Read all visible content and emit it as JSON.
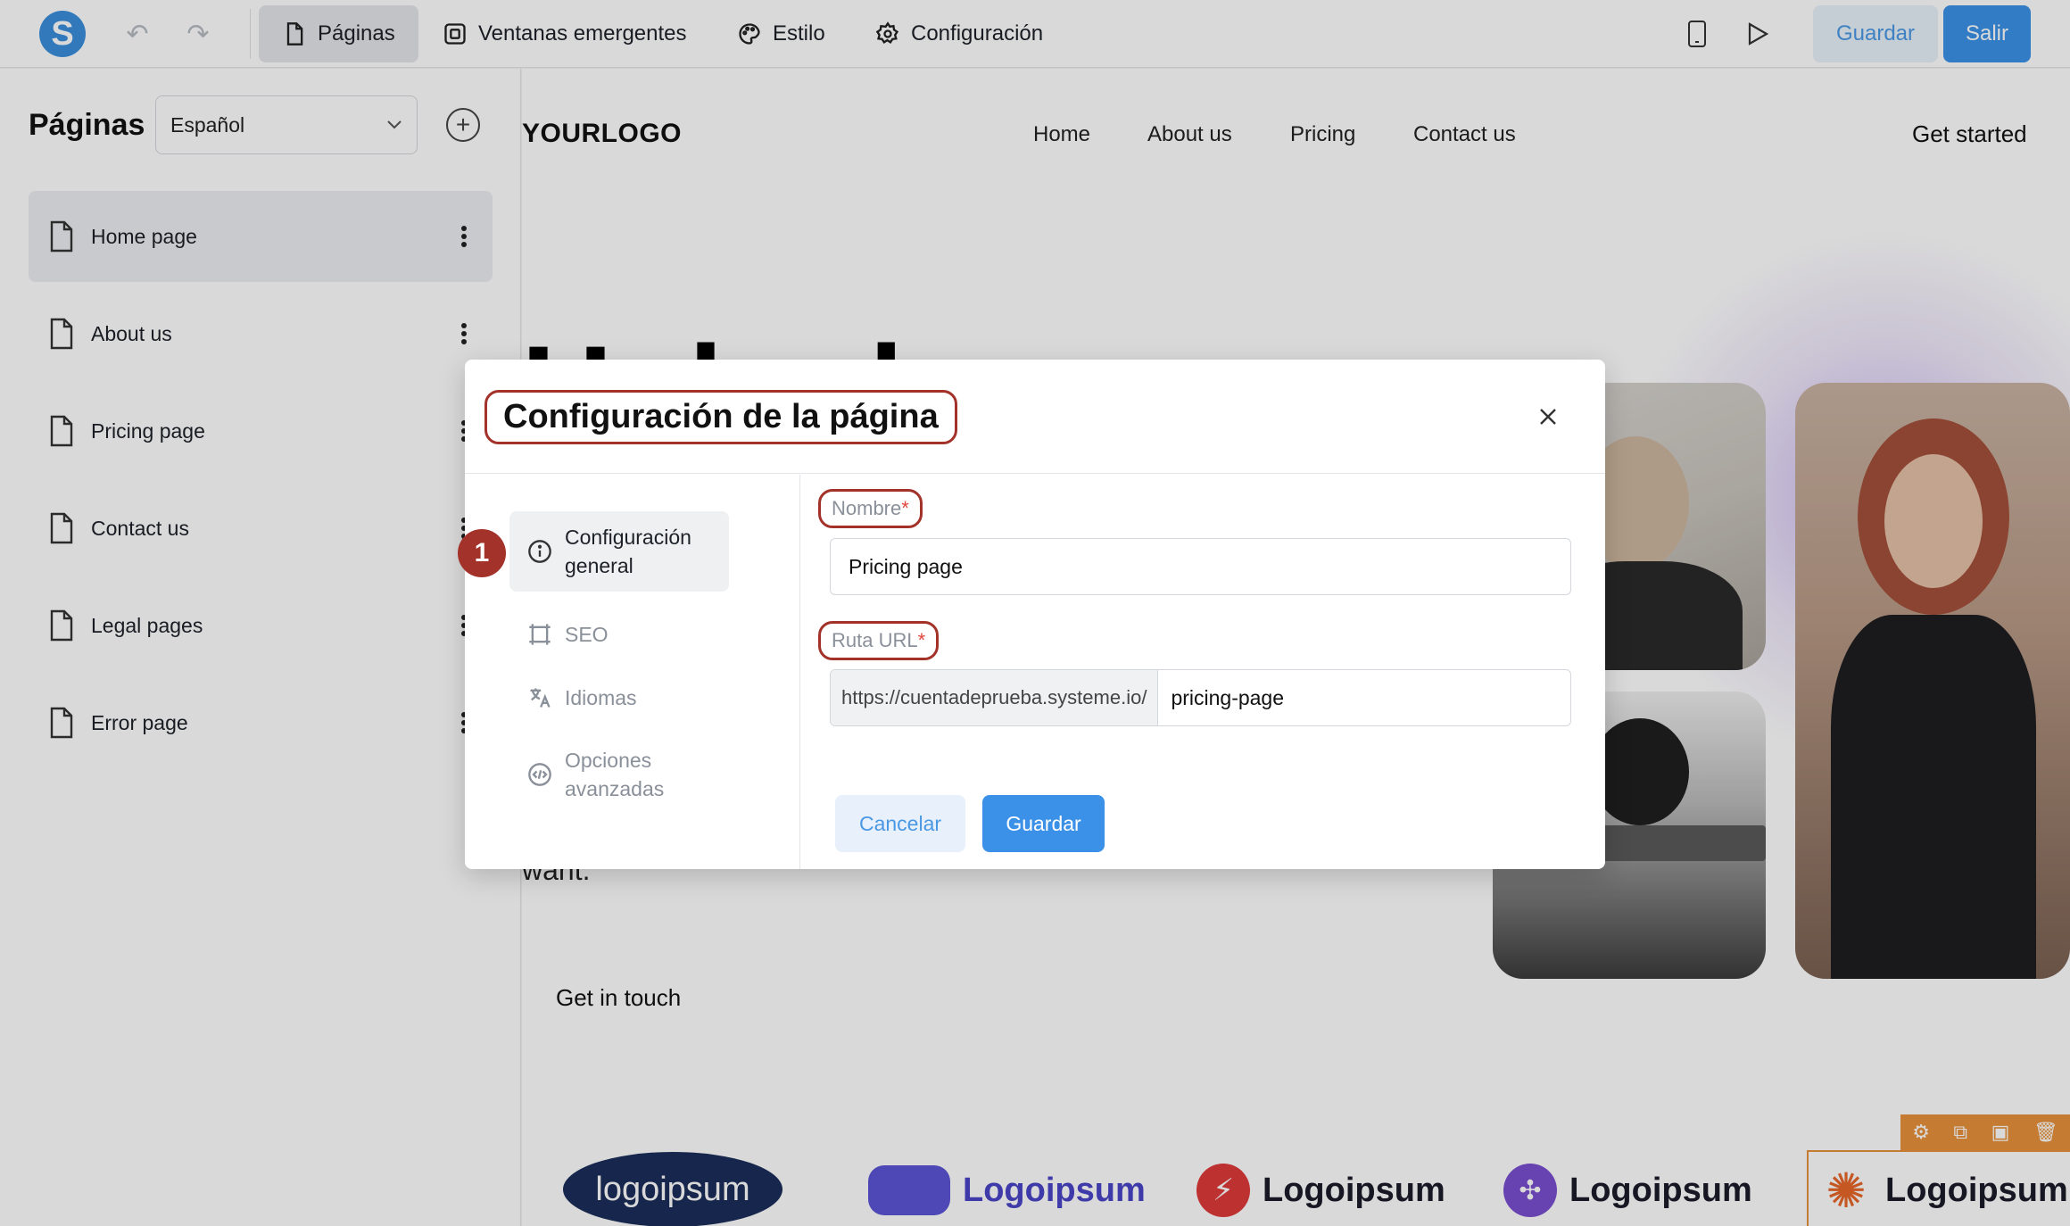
{
  "topbar": {
    "logo_letter": "S",
    "tabs": [
      {
        "label": "Páginas",
        "icon": "file-icon"
      },
      {
        "label": "Ventanas emergentes",
        "icon": "popup-icon"
      },
      {
        "label": "Estilo",
        "icon": "palette-icon"
      },
      {
        "label": "Configuración",
        "icon": "gear-icon"
      }
    ],
    "save_label": "Guardar",
    "exit_label": "Salir",
    "colors": {
      "primary": "#3b91e8",
      "primary_light": "#e8f1fb",
      "highlight": "#a2322a"
    }
  },
  "sidebar": {
    "title": "Páginas",
    "language": "Español",
    "items": [
      {
        "label": "Home page"
      },
      {
        "label": "About us"
      },
      {
        "label": "Pricing page"
      },
      {
        "label": "Contact us"
      },
      {
        "label": "Legal pages"
      },
      {
        "label": "Error page"
      }
    ]
  },
  "canvas": {
    "logo": "YOURLOGO",
    "nav": [
      "Home",
      "About us",
      "Pricing",
      "Contact us"
    ],
    "cta": "Get started",
    "hero_partial": "Unlock",
    "hero_text_partial": "want.",
    "get_in_touch": "Get in touch",
    "partner_logos": [
      "logoipsum",
      "Logoipsum",
      "Logoipsum",
      "Logoipsum",
      "Logoipsum"
    ]
  },
  "modal": {
    "title": "Configuración de la página",
    "step_badge": "1",
    "side_items": [
      {
        "label": "Configuración general",
        "icon": "info-icon"
      },
      {
        "label": "SEO",
        "icon": "seo-icon"
      },
      {
        "label": "Idiomas",
        "icon": "translate-icon"
      },
      {
        "label": "Opciones avanzadas",
        "icon": "code-icon"
      }
    ],
    "name_label": "Nombre",
    "name_value": "Pricing page",
    "url_label": "Ruta URL",
    "url_prefix": "https://cuentadeprueba.systeme.io/",
    "url_path": "pricing-page",
    "required_mark": "*",
    "cancel_label": "Cancelar",
    "save_label": "Guardar"
  }
}
